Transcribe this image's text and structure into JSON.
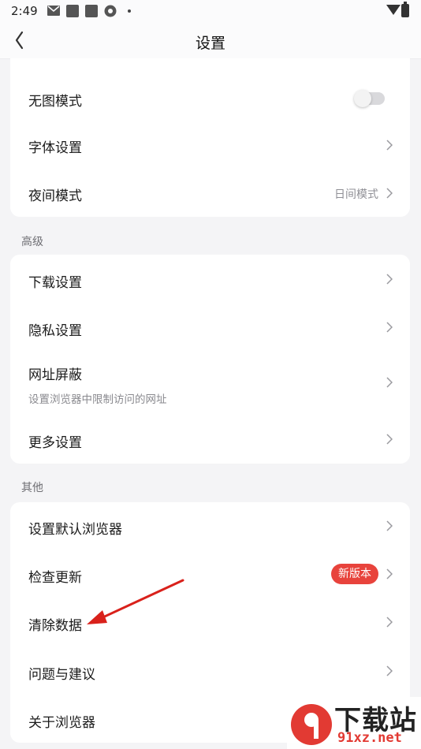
{
  "status_bar": {
    "time": "2:49"
  },
  "header": {
    "title": "设置",
    "back_icon": "chevron-left-icon"
  },
  "card_top": {
    "rows": [
      {
        "label": "无图模式",
        "control": "toggle",
        "toggle_on": false
      },
      {
        "label": "字体设置",
        "control": "chevron"
      },
      {
        "label": "夜间模式",
        "value": "日间模式",
        "control": "chevron"
      }
    ]
  },
  "section_advanced": {
    "title": "高级",
    "rows": [
      {
        "label": "下载设置"
      },
      {
        "label": "隐私设置"
      },
      {
        "label": "网址屏蔽",
        "subtitle": "设置浏览器中限制访问的网址"
      },
      {
        "label": "更多设置"
      }
    ]
  },
  "section_other": {
    "title": "其他",
    "rows": [
      {
        "label": "设置默认浏览器"
      },
      {
        "label": "检查更新",
        "badge": "新版本"
      },
      {
        "label": "清除数据"
      },
      {
        "label": "问题与建议"
      },
      {
        "label": "关于浏览器"
      }
    ]
  },
  "annotation": {
    "arrow_color": "#d9211b",
    "target": "清除数据"
  },
  "watermark": {
    "main": "下载站",
    "url": "91xz.net",
    "logo_glyph": "9"
  },
  "colors": {
    "accent": "#e8433c",
    "background": "#f4f4f6",
    "card": "#ffffff"
  }
}
